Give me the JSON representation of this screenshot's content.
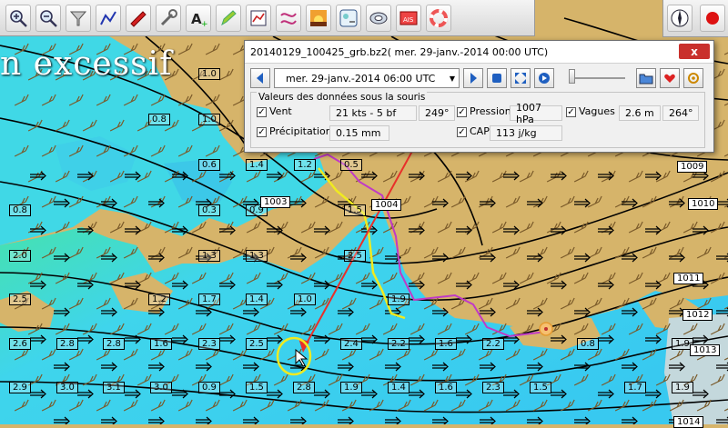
{
  "window": {
    "title": "20140129_100425_grb.bz2( mer. 29-janv.-2014 00:00  UTC)",
    "close_label": "x"
  },
  "overlay_text": "n excessif",
  "toolbar": {
    "tools": [
      {
        "name": "zoom-in-icon"
      },
      {
        "name": "zoom-out-icon"
      },
      {
        "name": "filter-icon"
      },
      {
        "name": "route-icon"
      },
      {
        "name": "boat-icon"
      },
      {
        "name": "wrench-icon"
      },
      {
        "name": "text-add-icon"
      },
      {
        "name": "pencil-icon"
      },
      {
        "name": "chart-icon"
      },
      {
        "name": "track-icon"
      },
      {
        "name": "sunset-icon"
      },
      {
        "name": "grib-icon"
      },
      {
        "name": "disk-icon"
      },
      {
        "name": "ais-icon"
      },
      {
        "name": "lifebuoy-icon"
      }
    ],
    "right": [
      {
        "name": "compass-icon"
      },
      {
        "name": "record-icon"
      }
    ]
  },
  "grib": {
    "date_value": "mer. 29-janv.-2014 06:00  UTC",
    "group_title": "Valeurs des données sous la souris",
    "vent": {
      "label": "Vent",
      "value": "21 kts -  5 bf",
      "dir": "249°"
    },
    "precip": {
      "label": "Précipitations",
      "value": "0.15 mm"
    },
    "pression": {
      "label": "Pression",
      "value": "1007 hPa"
    },
    "cape": {
      "label": "CAPE",
      "value": "113 j/kg"
    },
    "vagues": {
      "label": "Vagues",
      "value": "2.6 m",
      "dir": "264°"
    }
  },
  "colors": {
    "land": "#d6b46a",
    "sea_light": "#44d4ee",
    "sea_green": "#48e6a0",
    "track_pink": "#c03ac6",
    "track_yellow": "#f0ea20",
    "arrow_red": "#e8302a"
  },
  "map": {
    "wave_labels": [
      "1.0",
      "0.8",
      "1.0",
      "0.6",
      "1.4",
      "1.2",
      "0.5",
      "0.8",
      "0.3",
      "0.9",
      "1.5",
      "1.3",
      "1.3",
      "2.5",
      "2.0",
      "1.2",
      "1.7",
      "1.4",
      "1.0",
      "1.9",
      "2.5",
      "2.6",
      "2.8",
      "2.8",
      "1.6",
      "2.3",
      "2.5",
      "2.4",
      "2.2",
      "1.6",
      "2.2",
      "0.8",
      "1.9",
      "2.9",
      "3.0",
      "3.1",
      "3.0",
      "0.9",
      "1.5",
      "2.8",
      "1.9",
      "1.4",
      "1.6",
      "2.3",
      "1.5",
      "1.7",
      "1.9"
    ],
    "pressure_labels": [
      "1003",
      "1004",
      "1009",
      "1010",
      "1011",
      "1012",
      "1013",
      "1014"
    ]
  }
}
